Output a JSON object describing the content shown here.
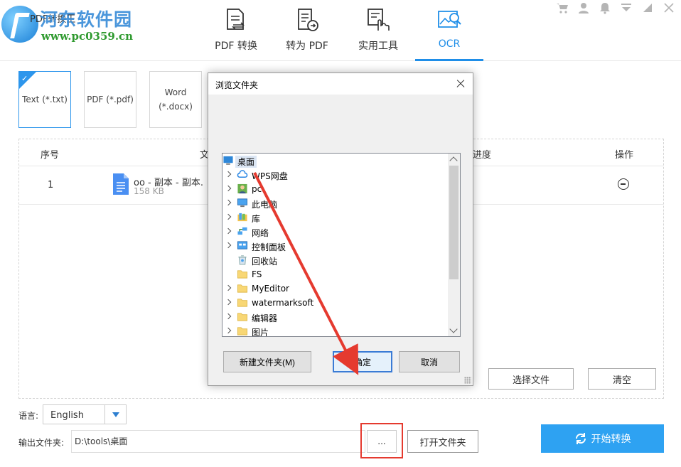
{
  "app": {
    "title": "PDF转换王",
    "watermark_cn": "河东软件园",
    "watermark_url": "www.pc0359.cn"
  },
  "tabs": [
    {
      "label": "PDF 转换",
      "icon": "pdf-convert-icon"
    },
    {
      "label": "转为 PDF",
      "icon": "to-pdf-icon"
    },
    {
      "label": "实用工具",
      "icon": "tools-hand-icon"
    },
    {
      "label": "OCR",
      "icon": "ocr-image-icon",
      "active": true
    }
  ],
  "formats": [
    {
      "label": "Text (*.txt)",
      "active": true
    },
    {
      "label": "PDF (*.pdf)"
    },
    {
      "label_line1": "Word",
      "label_line2": "(*.docx)"
    }
  ],
  "table": {
    "headers": {
      "index": "序号",
      "file": "文",
      "progress": "进度",
      "action": "操作"
    },
    "rows": [
      {
        "index": "1",
        "name": "oo - 副本 - 副本.",
        "size": "158 KB"
      }
    ]
  },
  "buttons": {
    "select_file": "选择文件",
    "clear": "清空",
    "browse": "...",
    "open_folder": "打开文件夹",
    "start": "开始转换"
  },
  "language": {
    "label": "语言:",
    "value": "English"
  },
  "output": {
    "label": "输出文件夹:",
    "path": "D:\\tools\\桌面"
  },
  "dialog": {
    "title": "浏览文件夹",
    "tree": [
      {
        "label": "桌面",
        "icon": "desktop-icon",
        "selected": true,
        "expandable": false,
        "level": 0
      },
      {
        "label": "WPS网盘",
        "icon": "cloud-icon",
        "expandable": true,
        "level": 1
      },
      {
        "label": "pc",
        "icon": "user-icon",
        "expandable": true,
        "level": 1
      },
      {
        "label": "此电脑",
        "icon": "computer-icon",
        "expandable": true,
        "level": 1
      },
      {
        "label": "库",
        "icon": "library-icon",
        "expandable": true,
        "level": 1
      },
      {
        "label": "网络",
        "icon": "network-icon",
        "expandable": true,
        "level": 1
      },
      {
        "label": "控制面板",
        "icon": "control-panel-icon",
        "expandable": true,
        "level": 1
      },
      {
        "label": "回收站",
        "icon": "recycle-bin-icon",
        "expandable": false,
        "level": 1
      },
      {
        "label": "FS",
        "icon": "folder-icon",
        "expandable": false,
        "level": 1
      },
      {
        "label": "MyEditor",
        "icon": "folder-icon",
        "expandable": true,
        "level": 1
      },
      {
        "label": "watermarksoft",
        "icon": "folder-icon",
        "expandable": true,
        "level": 1
      },
      {
        "label": "编辑器",
        "icon": "folder-icon",
        "expandable": true,
        "level": 1
      },
      {
        "label": "图片",
        "icon": "folder-icon",
        "expandable": true,
        "level": 1
      }
    ],
    "new_folder": "新建文件夹(M)",
    "ok": "确定",
    "cancel": "取消"
  },
  "colors": {
    "accent": "#1f8ee8",
    "start_button": "#2ea2f2",
    "highlight": "#e53a2f"
  }
}
